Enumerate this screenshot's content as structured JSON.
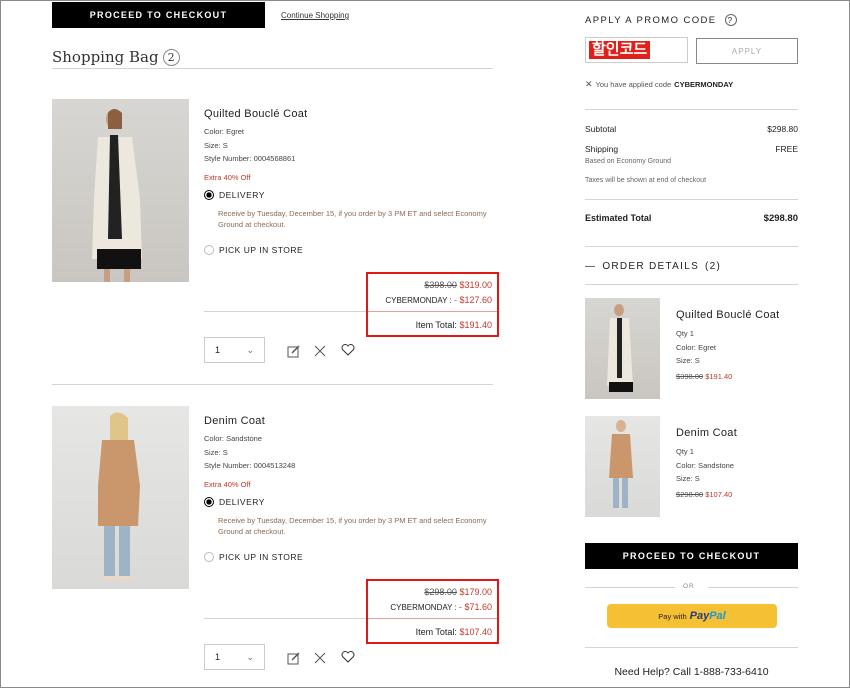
{
  "top": {
    "checkout_label": "PROCEED TO CHECKOUT",
    "continue_label": "Continue Shopping"
  },
  "bag": {
    "title": "Shopping Bag",
    "count": "2"
  },
  "items": [
    {
      "name": "Quilted Bouclé Coat",
      "color": "Color: Egret",
      "size": "Size: S",
      "style": "Style Number: 0004568861",
      "promo": "Extra 40% Off",
      "delivery_label": "DELIVERY",
      "delivery_note": "Receive by Tuesday, December 15, if you order by 3 PM ET and select Economy Ground at checkout.",
      "pickup_label": "PICK UP IN STORE",
      "orig_price": "$398.00",
      "sale_price": "$319.00",
      "discount_label": "CYBERMONDAY :",
      "discount": "- $127.60",
      "total_label": "Item Total:",
      "total": "$191.40",
      "qty": "1",
      "coat_color": "#ece8dd"
    },
    {
      "name": "Denim Coat",
      "color": "Color: Sandstone",
      "size": "Size: S",
      "style": "Style Number: 0004513248",
      "promo": "Extra 40% Off",
      "delivery_label": "DELIVERY",
      "delivery_note": "Receive by Tuesday, December 15, if you order by 3 PM ET and select Economy Ground at checkout.",
      "pickup_label": "PICK UP IN STORE",
      "orig_price": "$298.00",
      "sale_price": "$179.00",
      "discount_label": "CYBERMONDAY :",
      "discount": "- $71.60",
      "total_label": "Item Total:",
      "total": "$107.40",
      "qty": "1",
      "coat_color": "#c9976b"
    }
  ],
  "promo": {
    "heading": "APPLY A PROMO CODE",
    "help": "?",
    "input_value": "할인코드",
    "apply_label": "APPLY",
    "applied_text": "You have applied code",
    "applied_code": "CYBERMONDAY"
  },
  "summary": {
    "subtotal_label": "Subtotal",
    "subtotal": "$298.80",
    "shipping_label": "Shipping",
    "shipping": "FREE",
    "shipping_note": "Based on Economy Ground",
    "taxes_note": "Taxes will be shown at end of checkout",
    "estimated_label": "Estimated Total",
    "estimated": "$298.80"
  },
  "order_details": {
    "heading": "ORDER DETAILS",
    "count": "(2)",
    "items": [
      {
        "name": "Quilted Bouclé Coat",
        "qty": "Qty 1",
        "color": "Color: Egret",
        "size": "Size: S",
        "orig": "$398.00",
        "price": "$191.40"
      },
      {
        "name": "Denim Coat",
        "qty": "Qty 1",
        "color": "Color: Sandstone",
        "size": "Size: S",
        "orig": "$298.00",
        "price": "$107.40"
      }
    ]
  },
  "checkout": {
    "label": "PROCEED TO CHECKOUT",
    "or": "OR",
    "paypal_prefix": "Pay with",
    "paypal_pay": "Pay",
    "paypal_pal": "Pal"
  },
  "help": {
    "text": "Need Help? Call 1-888-733-6410"
  },
  "colors": {
    "accent_red": "#c0392b",
    "box_red": "#e01818",
    "paypal_yellow": "#f5c033"
  }
}
